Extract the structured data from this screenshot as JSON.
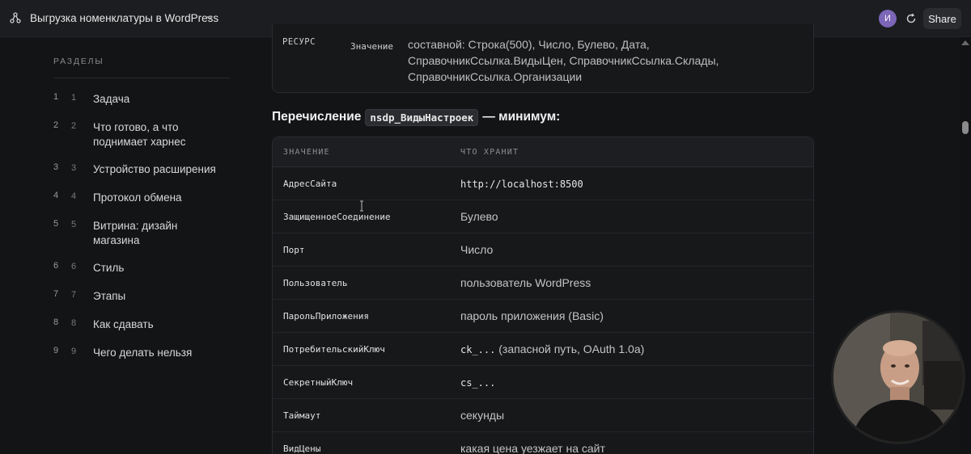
{
  "topbar": {
    "title": "Выгрузка номенклатуры в WordPress",
    "avatar_initial": "И",
    "share_label": "Share"
  },
  "sidebar": {
    "heading": "РАЗДЕЛЫ",
    "items": [
      {
        "n1": "1",
        "n2": "1",
        "label": "Задача"
      },
      {
        "n1": "2",
        "n2": "2",
        "label": "Что готово, а что поднимает харнес"
      },
      {
        "n1": "3",
        "n2": "3",
        "label": "Устройство расширения"
      },
      {
        "n1": "4",
        "n2": "4",
        "label": "Протокол обмена"
      },
      {
        "n1": "5",
        "n2": "5",
        "label": "Витрина: дизайн магазина"
      },
      {
        "n1": "6",
        "n2": "6",
        "label": "Стиль"
      },
      {
        "n1": "7",
        "n2": "7",
        "label": "Этапы"
      },
      {
        "n1": "8",
        "n2": "8",
        "label": "Как сдавать"
      },
      {
        "n1": "9",
        "n2": "9",
        "label": "Чего делать нельзя"
      }
    ]
  },
  "resource_block": {
    "key": "РЕСУРС",
    "sub": "Значение",
    "value": "составной: Строка(500), Число, Булево, Дата, СправочникСсылка.ВидыЦен, СправочникСсылка.Склады, СправочникСсылка.Организации"
  },
  "section": {
    "prefix": "Перечисление",
    "code": "nsdp_ВидыНастроек",
    "suffix": "— минимум:"
  },
  "table": {
    "headers": [
      "ЗНАЧЕНИЕ",
      "ЧТО ХРАНИТ"
    ],
    "rows": [
      {
        "key": "АдресСайта",
        "val_mono": "http://localhost:8500",
        "val": ""
      },
      {
        "key": "ЗащищенноеСоединение",
        "val_mono": "",
        "val": "Булево"
      },
      {
        "key": "Порт",
        "val_mono": "",
        "val": "Число"
      },
      {
        "key": "Пользователь",
        "val_mono": "",
        "val": "пользователь WordPress"
      },
      {
        "key": "ПарольПриложения",
        "val_mono": "",
        "val": "пароль приложения (Basic)"
      },
      {
        "key": "ПотребительскийКлюч",
        "val_mono": "ck_...",
        "val": " (запасной путь, OAuth 1.0a)"
      },
      {
        "key": "СекретныйКлюч",
        "val_mono": "cs_...",
        "val": ""
      },
      {
        "key": "Таймаут",
        "val_mono": "",
        "val": "секунды"
      },
      {
        "key": "ВидЦены",
        "val_mono": "",
        "val": "какая цена уезжает на сайт"
      }
    ]
  },
  "icons": {
    "doc": "share-nodes-icon",
    "chevron": "chevron-down-icon",
    "refresh": "refresh-icon",
    "cursor": "text-cursor-icon"
  }
}
